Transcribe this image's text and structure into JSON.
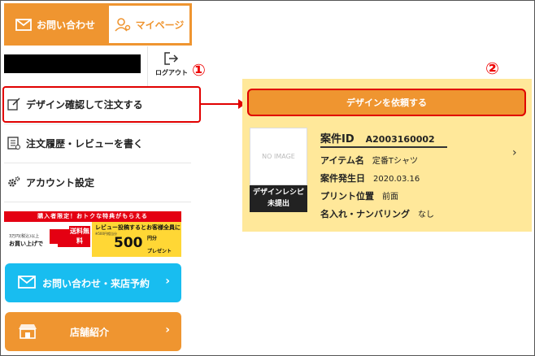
{
  "tabs": {
    "contact": "お問い合わせ",
    "mypage": "マイページ"
  },
  "logout": {
    "label": "ログアウト"
  },
  "annotations": {
    "one": "①",
    "two": "②"
  },
  "menu": {
    "items": [
      {
        "label": "デザイン確認して注文する",
        "icon": "edit-icon"
      },
      {
        "label": "注文履歴・レビューを書く",
        "icon": "list-icon"
      },
      {
        "label": "アカウント設定",
        "icon": "gear-icon"
      }
    ]
  },
  "banner": {
    "top": "購入者限定！おトクな特典がもらえる",
    "left_small": "3万円(税込)以上",
    "left_main": "お買い上げで",
    "free": "送料無料",
    "right_main": "レビュー投稿するとお客様全員に",
    "right_small": "※500円相当分",
    "amount": "500",
    "unit": "円分",
    "present": "プレゼント"
  },
  "buttons": {
    "contact_visit": "お問い合わせ・来店予約",
    "stores": "店舗紹介",
    "chevron": "›"
  },
  "order": {
    "button_label": "デザインを依頼する",
    "no_image": "NO IMAGE",
    "recipe_line1": "デザインレシピ",
    "recipe_line2": "未提出",
    "case_id_label": "案件ID",
    "case_id_value": "A2003160002",
    "rows": [
      {
        "label": "アイテム名",
        "value": "定番Tシャツ"
      },
      {
        "label": "案件発生日",
        "value": "2020.03.16"
      },
      {
        "label": "プリント位置",
        "value": "前面"
      },
      {
        "label": "名入れ・ナンバリング",
        "value": "なし"
      }
    ],
    "chevron": "›"
  },
  "colors": {
    "accent": "#ef9530",
    "blue": "#18bdf0",
    "panel": "#ffe89a",
    "highlight": "#e10000"
  }
}
